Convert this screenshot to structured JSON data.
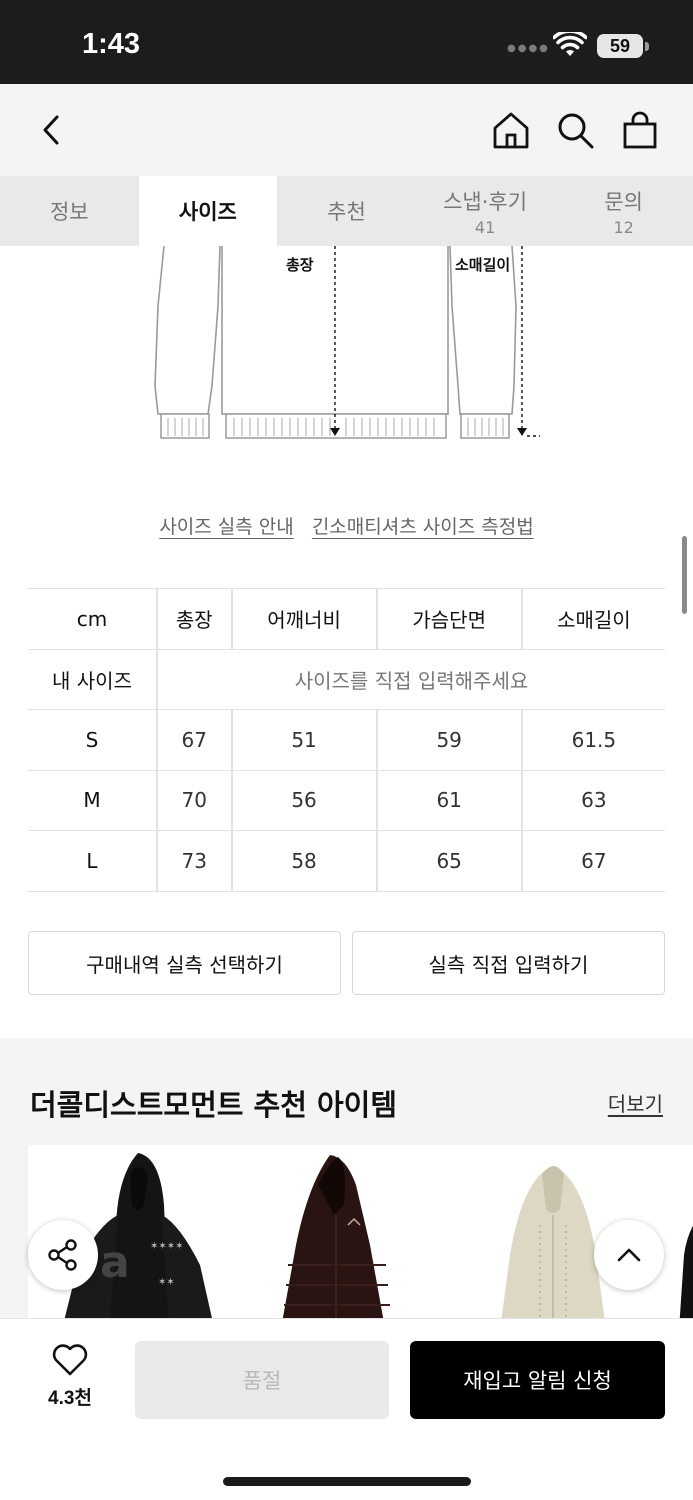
{
  "status_bar": {
    "time": "1:43",
    "battery": "59"
  },
  "header": {
    "icons": [
      "back-icon",
      "home-icon",
      "search-icon",
      "shopping-bag-icon"
    ]
  },
  "tabs": [
    {
      "label": "정보",
      "count": ""
    },
    {
      "label": "사이즈",
      "count": ""
    },
    {
      "label": "추천",
      "count": ""
    },
    {
      "label": "스냅·후기",
      "count": "41"
    },
    {
      "label": "문의",
      "count": "12"
    }
  ],
  "illustration": {
    "length_label": "총장",
    "sleeve_label": "소매길이"
  },
  "guide_links": {
    "size_guide": "사이즈 실측 안내",
    "measure_method": "긴소매티셔츠 사이즈 측정법"
  },
  "size_table": {
    "headers": [
      "cm",
      "총장",
      "어깨너비",
      "가슴단면",
      "소매길이"
    ],
    "my_size": {
      "label": "내 사이즈",
      "placeholder": "사이즈를 직접 입력해주세요"
    },
    "rows": [
      {
        "size": "S",
        "values": [
          "67",
          "51",
          "59",
          "61.5"
        ]
      },
      {
        "size": "M",
        "values": [
          "70",
          "56",
          "61",
          "63"
        ]
      },
      {
        "size": "L",
        "values": [
          "73",
          "58",
          "65",
          "67"
        ]
      }
    ]
  },
  "buttons": {
    "purchase_history": "구매내역 실측 선택하기",
    "direct_input": "실측 직접 입력하기"
  },
  "recommendations": {
    "title": "더콜디스트모먼트 추천 아이템",
    "more": "더보기"
  },
  "bottom_bar": {
    "like_count": "4.3천",
    "soldout": "품절",
    "restock": "재입고 알림 신청"
  },
  "colors": {
    "accent": "#000000",
    "tab_bg": "#e9e9e9",
    "disabled_bg": "#e9e9e9"
  }
}
